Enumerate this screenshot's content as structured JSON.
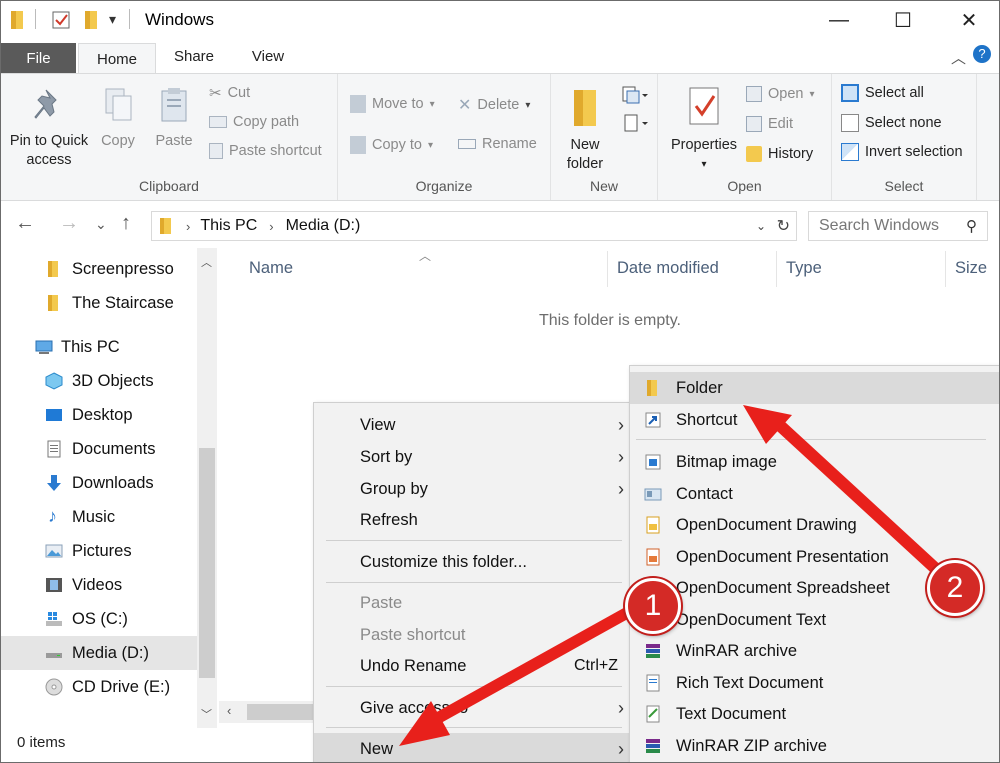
{
  "window": {
    "title": "Windows",
    "minimize": "—",
    "maximize": "☐",
    "close": "✕"
  },
  "tabs": {
    "file": "File",
    "home": "Home",
    "share": "Share",
    "view": "View"
  },
  "ribbon": {
    "clipboard": {
      "label": "Clipboard",
      "pin": "Pin to Quick\naccess",
      "pin1": "Pin to Quick",
      "pin2": "access",
      "copy": "Copy",
      "paste": "Paste",
      "cut": "Cut",
      "copy_path": "Copy path",
      "paste_shortcut": "Paste shortcut"
    },
    "organize": {
      "label": "Organize",
      "move_to": "Move to",
      "copy_to": "Copy to",
      "delete": "Delete",
      "rename": "Rename"
    },
    "new": {
      "label": "New",
      "new_folder1": "New",
      "new_folder2": "folder"
    },
    "open": {
      "label": "Open",
      "properties": "Properties",
      "open": "Open",
      "edit": "Edit",
      "history": "History"
    },
    "select": {
      "label": "Select",
      "select_all": "Select all",
      "select_none": "Select none",
      "invert": "Invert selection"
    }
  },
  "address": {
    "this_pc": "This PC",
    "media": "Media (D:)",
    "search_placeholder": "Search Windows"
  },
  "nav": {
    "items": [
      {
        "label": "Screenpresso"
      },
      {
        "label": "The Staircase"
      },
      {
        "label": "This PC"
      },
      {
        "label": "3D Objects"
      },
      {
        "label": "Desktop"
      },
      {
        "label": "Documents"
      },
      {
        "label": "Downloads"
      },
      {
        "label": "Music"
      },
      {
        "label": "Pictures"
      },
      {
        "label": "Videos"
      },
      {
        "label": "OS (C:)"
      },
      {
        "label": "Media (D:)"
      },
      {
        "label": "CD Drive (E:)"
      }
    ]
  },
  "columns": {
    "name": "Name",
    "date": "Date modified",
    "type": "Type",
    "size": "Size"
  },
  "content": {
    "empty": "This folder is empty."
  },
  "status": {
    "items": "0 items"
  },
  "context_menu": {
    "view": "View",
    "sort_by": "Sort by",
    "group_by": "Group by",
    "refresh": "Refresh",
    "customize": "Customize this folder...",
    "paste": "Paste",
    "paste_shortcut": "Paste shortcut",
    "undo_rename": "Undo Rename",
    "undo_shortcut": "Ctrl+Z",
    "give_access": "Give access to",
    "new": "New"
  },
  "new_menu": {
    "items": [
      {
        "label": "Folder"
      },
      {
        "label": "Shortcut"
      },
      {
        "label": "Bitmap image"
      },
      {
        "label": "Contact"
      },
      {
        "label": "OpenDocument Drawing"
      },
      {
        "label": "OpenDocument Presentation"
      },
      {
        "label": "OpenDocument Spreadsheet"
      },
      {
        "label": "OpenDocument Text"
      },
      {
        "label": "WinRAR archive"
      },
      {
        "label": "Rich Text Document"
      },
      {
        "label": "Text Document"
      },
      {
        "label": "WinRAR ZIP archive"
      }
    ]
  },
  "annotations": {
    "step1": "1",
    "step2": "2",
    "arrow_color": "#e8201b"
  }
}
